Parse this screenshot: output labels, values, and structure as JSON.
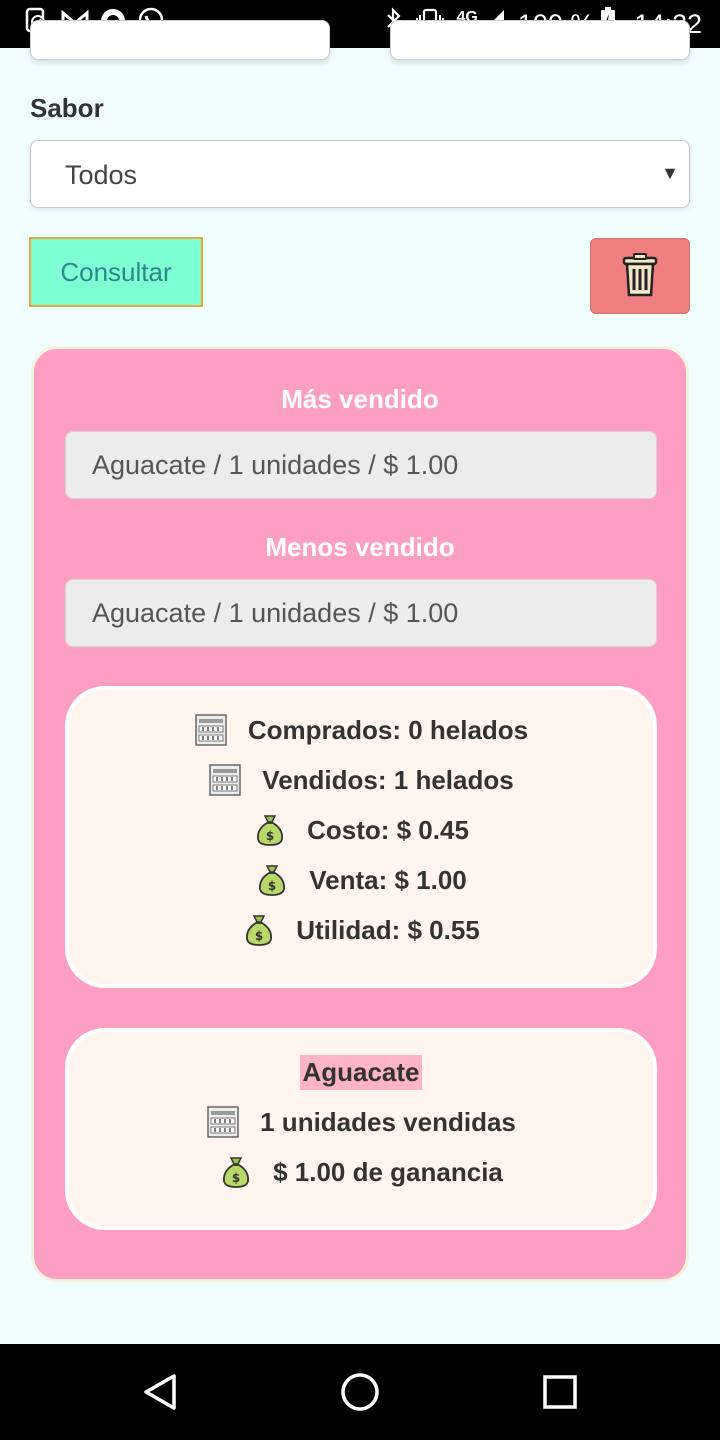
{
  "status_bar": {
    "network": "4G",
    "battery": "100 %",
    "time": "14:22",
    "icons_left": [
      "screenshot-icon",
      "gmail-icon",
      "record-icon",
      "whatsapp-icon"
    ],
    "icons_right": [
      "bluetooth-icon",
      "vibrate-icon",
      "signal-icon",
      "battery-icon"
    ]
  },
  "form": {
    "sabor_label": "Sabor",
    "sabor_value": "Todos",
    "select_arrow": "▼",
    "consultar_label": "Consultar"
  },
  "summary": {
    "mas_vendido_label": "Más vendido",
    "mas_vendido_value": "Aguacate / 1 unidades / $ 1.00",
    "menos_vendido_label": "Menos vendido",
    "menos_vendido_value": "Aguacate / 1 unidades / $ 1.00",
    "stats": [
      {
        "icon": "abacus-icon",
        "text": "Comprados: 0 helados"
      },
      {
        "icon": "abacus-icon",
        "text": "Vendidos: 1 helados"
      },
      {
        "icon": "money-bag-icon",
        "text": "Costo: $ 0.45"
      },
      {
        "icon": "money-bag-icon",
        "text": "Venta: $ 1.00"
      },
      {
        "icon": "money-bag-icon",
        "text": "Utilidad: $ 0.55"
      }
    ],
    "flavor": {
      "name": "Aguacate",
      "units": "1 unidades vendidas",
      "profit": "$ 1.00 de ganancia"
    }
  },
  "colors": {
    "background": "#f0fffe",
    "card": "#ff9ec3",
    "consultar_bg": "#7fffd4",
    "trash_bg": "#f08080",
    "inner_box": "#fff4ee"
  }
}
